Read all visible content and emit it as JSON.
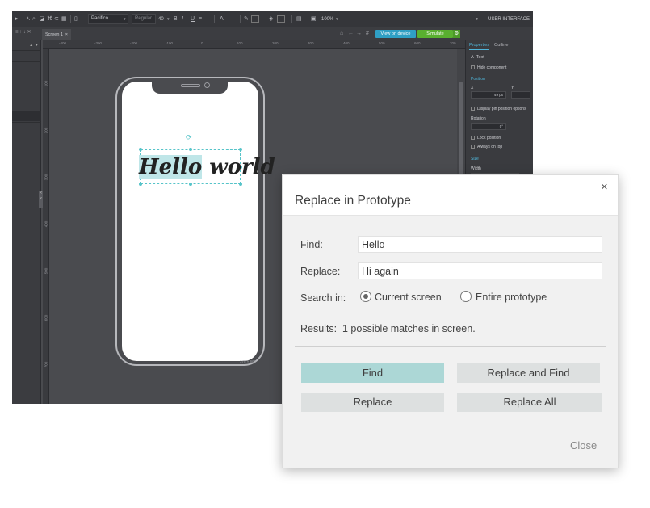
{
  "toolbar": {
    "font_family": "Pacifico",
    "font_weight": "Regular",
    "font_size": "40",
    "underline": "U",
    "text_color_label": "A",
    "zoom": "100%",
    "mode_label": "USER INTERFACE"
  },
  "tabs": {
    "screen_tab": "Screen 1",
    "close": "×"
  },
  "canvas_actions": {
    "view_on_device": "View on device",
    "simulate": "Simulate"
  },
  "rulers": {
    "top": [
      "-400",
      "-300",
      "-200",
      "-100",
      "0",
      "100",
      "200",
      "300",
      "400",
      "500",
      "600",
      "700"
    ],
    "left": [
      "100",
      "200",
      "300",
      "400",
      "500",
      "600",
      "700"
    ]
  },
  "phone": {
    "text_highlight": "Hello",
    "text_rest": " world",
    "size_label": "375 × 667"
  },
  "properties": {
    "tab_properties": "Properties",
    "tab_outline": "Outline",
    "section_text": "Text",
    "hide_component": "Hide component",
    "position": "Position",
    "x_label": "X",
    "y_label": "Y",
    "x_value": "49",
    "x_unit": "px",
    "display_pin": "Display pin position options",
    "rotation": "Rotation",
    "rotation_value": "0°",
    "lock_position": "Lock position",
    "always_on_top": "Always on top",
    "size": "Size",
    "width": "Width",
    "width_value": "277",
    "width_unit": "px"
  },
  "dialog": {
    "title": "Replace in Prototype",
    "find_label": "Find:",
    "find_value": "Hello",
    "replace_label": "Replace:",
    "replace_value": "Hi again",
    "search_in_label": "Search in:",
    "option_current": "Current screen",
    "option_entire": "Entire prototype",
    "results_label": "Results:",
    "results_value": "1 possible matches in screen.",
    "btn_find": "Find",
    "btn_replace_find": "Replace and Find",
    "btn_replace": "Replace",
    "btn_replace_all": "Replace All",
    "close_link": "Close",
    "close_x": "×"
  },
  "colors": {
    "accent_teal": "#acd7d6",
    "selection": "#56c4c9",
    "view_btn": "#2f9fc4",
    "simulate_btn": "#59b02f"
  }
}
